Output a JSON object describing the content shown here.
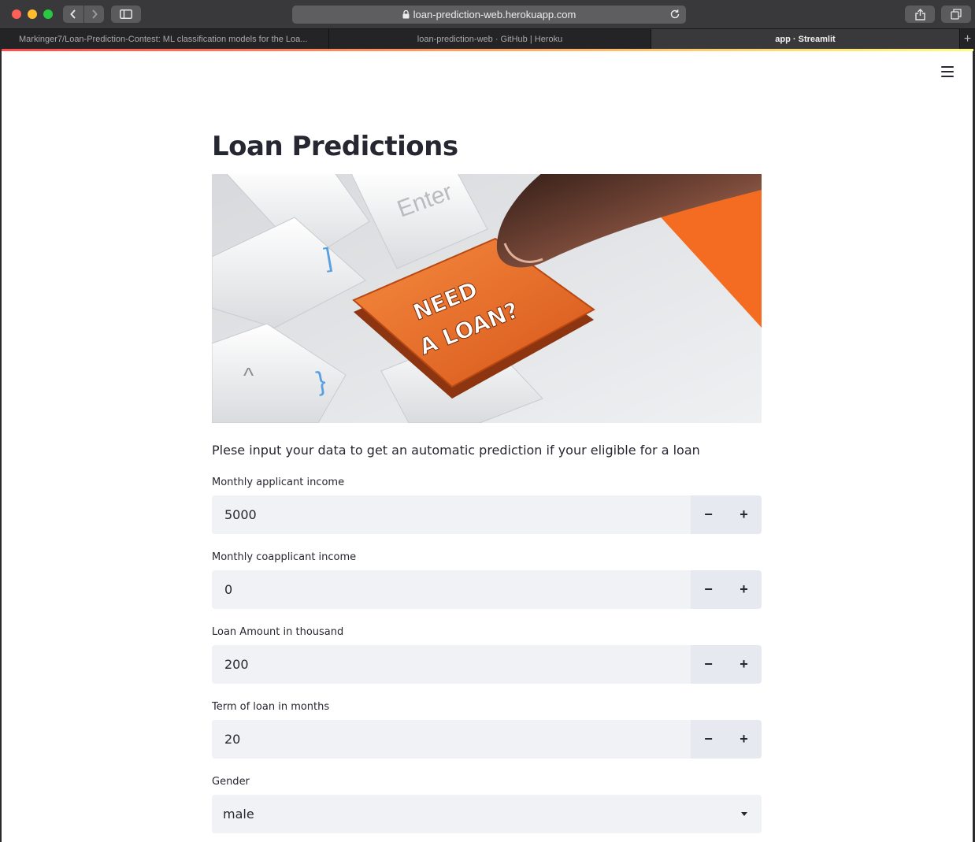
{
  "browser": {
    "url": "loan-prediction-web.herokuapp.com",
    "tabs": [
      {
        "label": "Markinger7/Loan-Prediction-Contest: ML classification models for the Loa..."
      },
      {
        "label": "loan-prediction-web · GitHub | Heroku"
      },
      {
        "label": "app · Streamlit"
      }
    ],
    "new_tab": "+"
  },
  "app": {
    "title": "Loan Predictions",
    "hero": {
      "alt": "Keyboard with orange key",
      "key_line1": "NEED",
      "key_line2": "A LOAN?",
      "enter_key": "Enter"
    },
    "intro": "Plese input your data to get an automatic prediction if your eligible for a loan",
    "fields": [
      {
        "label": "Monthly applicant income",
        "value": "5000"
      },
      {
        "label": "Monthly coapplicant income",
        "value": "0"
      },
      {
        "label": "Loan Amount in thousand",
        "value": "200"
      },
      {
        "label": "Term of loan in months",
        "value": "20"
      }
    ],
    "stepper": {
      "minus": "−",
      "plus": "+"
    },
    "gender": {
      "label": "Gender",
      "value": "male"
    }
  },
  "colors": {
    "accent": "#ff4b4b",
    "orange": "#f36c21",
    "input_bg": "#f0f2f6"
  }
}
